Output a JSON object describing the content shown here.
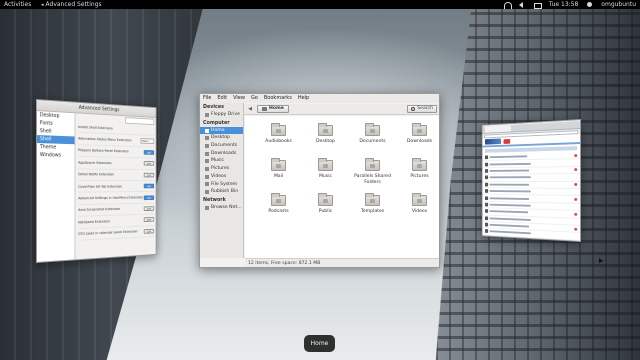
{
  "topbar": {
    "activities": "Activities",
    "app_menu": "Advanced Settings",
    "clock": "Tue 13:58",
    "user": "omgubuntu"
  },
  "advanced_settings": {
    "title": "Advanced Settings",
    "sidebar": [
      "Desktop",
      "Fonts",
      "Shell",
      "Shell Extensions",
      "Theme",
      "Windows"
    ],
    "selected_index": 3,
    "rows": [
      {
        "label": "Install Shell Extension",
        "control": "none",
        "value": ""
      },
      {
        "label": "Alternative Status Menu Extension",
        "control": "dropdown",
        "value": "Menu"
      },
      {
        "label": "Plippery Bottom Panel Extension",
        "control": "toggle",
        "value": "ON"
      },
      {
        "label": "AppSearch Extension",
        "control": "toggle",
        "value": "OFF"
      },
      {
        "label": "Detail Notify Extension",
        "control": "toggle",
        "value": "OFF"
      },
      {
        "label": "CoverFlow Alt Tab Extension",
        "control": "toggle",
        "value": "ON"
      },
      {
        "label": "Advanced Settings in UserMenu Extension",
        "control": "toggle",
        "value": "ON"
      },
      {
        "label": "Area Screenshot Extension",
        "control": "toggle",
        "value": "OFF"
      },
      {
        "label": "NetSpeed Extension",
        "control": "toggle",
        "value": "OFF"
      },
      {
        "label": "GTG tasks in calendar panel Extension",
        "control": "toggle",
        "value": "OFF"
      }
    ]
  },
  "files": {
    "menu": [
      "File",
      "Edit",
      "View",
      "Go",
      "Bookmarks",
      "Help"
    ],
    "path": "Home",
    "search_label": "Search",
    "sidebar": {
      "devices_header": "Devices",
      "devices": [
        "Floppy Drive"
      ],
      "computer_header": "Computer",
      "computer": [
        "Home",
        "Desktop",
        "Documents",
        "Downloads",
        "Music",
        "Pictures",
        "Videos",
        "File System",
        "Rubbish Bin"
      ],
      "network_header": "Network",
      "network": [
        "Browse Net..."
      ]
    },
    "items": [
      "Audiobooks",
      "Desktop",
      "Documents",
      "Downloads",
      "Mail",
      "Music",
      "Parallels Shared Folders",
      "Pictures",
      "Podcasts",
      "Public",
      "Templates",
      "Videos"
    ],
    "status": "12 items, Free space: 872.1 MB"
  },
  "window_label": "Home"
}
